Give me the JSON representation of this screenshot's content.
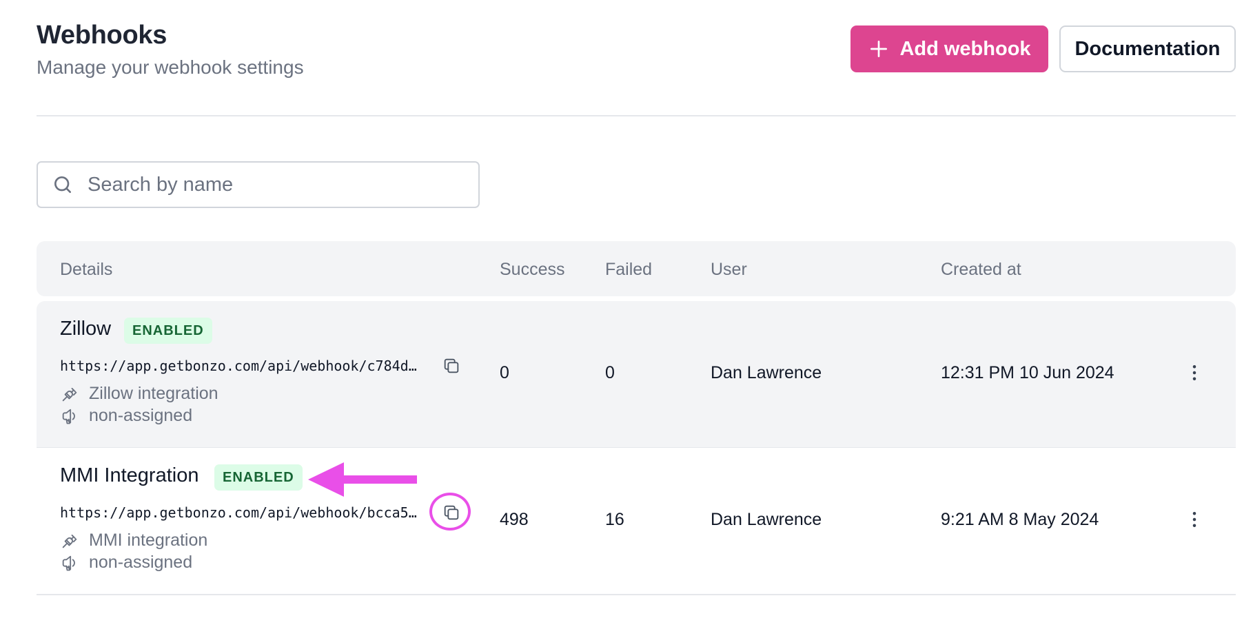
{
  "header": {
    "title": "Webhooks",
    "subtitle": "Manage your webhook settings",
    "add_button": "Add webhook",
    "docs_button": "Documentation"
  },
  "search": {
    "placeholder": "Search by name",
    "value": ""
  },
  "table": {
    "columns": [
      "Details",
      "Success",
      "Failed",
      "User",
      "Created at"
    ],
    "rows": [
      {
        "name": "Zillow",
        "status": "ENABLED",
        "url": "https://app.getbonzo.com/api/webhook/c784d…",
        "integration": "Zillow integration",
        "assignment": "non-assigned",
        "success": "0",
        "failed": "0",
        "user": "Dan Lawrence",
        "created_at": "12:31 PM 10 Jun 2024"
      },
      {
        "name": "MMI Integration",
        "status": "ENABLED",
        "url": "https://app.getbonzo.com/api/webhook/bcca5…",
        "integration": "MMI integration",
        "assignment": "non-assigned",
        "success": "498",
        "failed": "16",
        "user": "Dan Lawrence",
        "created_at": "9:21 AM 8 May 2024"
      }
    ]
  },
  "colors": {
    "accent": "#dd4590",
    "badge_bg": "#dcfce7",
    "badge_text": "#166534",
    "annotation": "#e94fe8"
  },
  "icons": [
    "plus-icon",
    "search-icon",
    "copy-icon",
    "plug-icon",
    "megaphone-icon",
    "more-vertical-icon",
    "annotation-arrow"
  ]
}
